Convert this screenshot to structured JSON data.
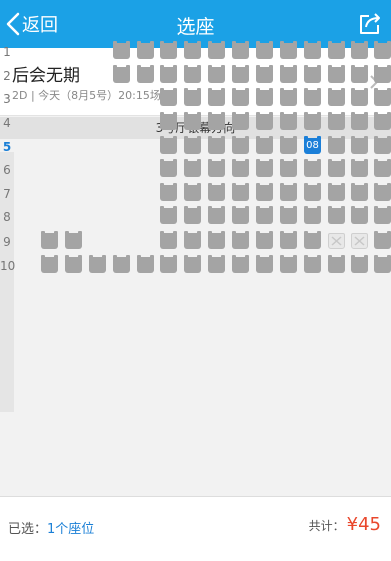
{
  "header": {
    "back_label": "返回",
    "title": "选座",
    "back_icon": "chevron-left-icon",
    "share_icon": "share-icon"
  },
  "movie": {
    "name": "后会无期",
    "info": "2D | 今天（8月5号）20:15场"
  },
  "screen": {
    "label": "3号厅银幕方向"
  },
  "seat_map": {
    "row_labels": [
      "1",
      "2",
      "3",
      "4",
      "5",
      "6",
      "7",
      "8",
      "9",
      "10"
    ],
    "active_row": "5",
    "selected_seat": {
      "row": "5",
      "label": "08"
    }
  },
  "footer": {
    "selected_label": "已选：",
    "selected_count": "1个座位",
    "total_label": "共计：",
    "total_price": "¥45"
  },
  "colors": {
    "accent": "#1ba1e6",
    "selected": "#1b7fd8",
    "price": "#e9472c",
    "seat": "#a4a4a4"
  }
}
